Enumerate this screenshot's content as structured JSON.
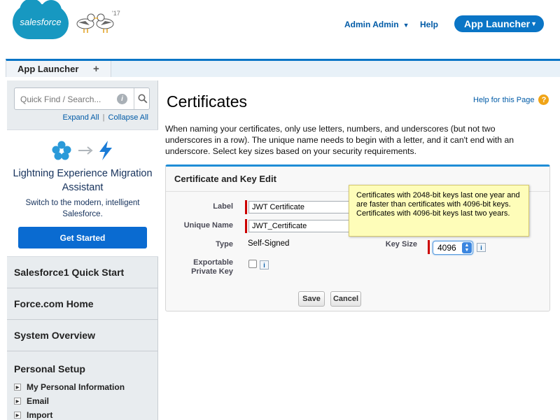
{
  "header": {
    "logo_text": "salesforce",
    "mascot_badge": "'17",
    "user_menu_label": "Admin Admin",
    "help_label": "Help",
    "app_launcher_label": "App Launcher"
  },
  "tabs": {
    "active_label": "App Launcher",
    "add_symbol": "+"
  },
  "sidebar": {
    "search_placeholder": "Quick Find / Search...",
    "expand_all": "Expand All",
    "collapse_all": "Collapse All",
    "separator": "|",
    "promo": {
      "title": "Lightning Experience Migration Assistant",
      "subtitle": "Switch to the modern, intelligent Salesforce.",
      "button_label": "Get Started"
    },
    "sections": [
      "Salesforce1 Quick Start",
      "Force.com Home",
      "System Overview"
    ],
    "personal_setup": {
      "title": "Personal Setup",
      "items": [
        "My Personal Information",
        "Email",
        "Import"
      ]
    }
  },
  "main": {
    "title": "Certificates",
    "help_link": "Help for this Page",
    "description": "When naming your certificates, only use letters, numbers, and underscores (but not two underscores in a row). The unique name needs to begin with a letter, and it can't end with an underscore. Select key sizes based on your security requirements.",
    "panel": {
      "title": "Certificate and Key Edit",
      "label_label": "Label",
      "label_value": "JWT Certificate",
      "unique_name_label": "Unique Name",
      "unique_name_value": "JWT_Certificate",
      "type_label": "Type",
      "type_value": "Self-Signed",
      "key_size_label": "Key Size",
      "key_size_value": "4096",
      "exportable_label": "Exportable Private Key",
      "tooltip": "Certificates with 2048-bit keys last one year and are faster than certificates with 4096-bit keys. Certificates with 4096-bit keys last two years.",
      "save_label": "Save",
      "cancel_label": "Cancel"
    }
  },
  "colors": {
    "brand_blue": "#1798c1",
    "button_blue": "#0a75c6",
    "link_blue": "#015ba7",
    "required_red": "#cc0000",
    "tooltip_yellow": "#fefdb9"
  }
}
